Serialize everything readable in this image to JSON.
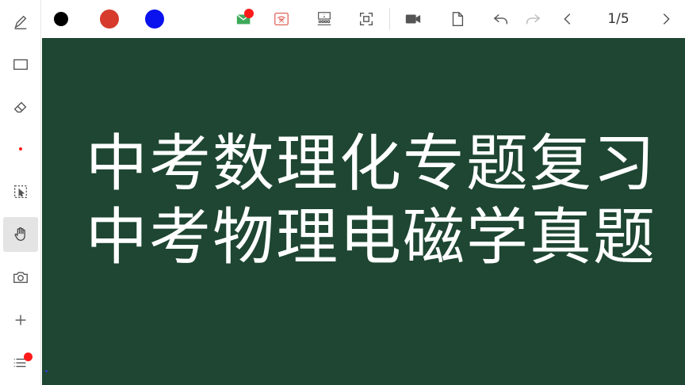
{
  "toolbar": {
    "colors": [
      {
        "name": "black",
        "hex": "#000000"
      },
      {
        "name": "red",
        "hex": "#d63b2b"
      },
      {
        "name": "blue",
        "hex": "#0a12ee"
      }
    ],
    "icons": [
      "envelope-icon",
      "cast-icon",
      "classroom-icon",
      "fullscreen-icon",
      "video-camera-icon",
      "document-icon",
      "undo-icon",
      "redo-icon",
      "prev-page-icon",
      "next-page-icon"
    ],
    "page_indicator": "1/5"
  },
  "sidebar": {
    "tools": [
      "pen-tool",
      "rectangle-tool",
      "eraser-tool",
      "pointer-dot",
      "select-tool",
      "hand-tool",
      "camera-tool",
      "add-tool",
      "menu-tool"
    ],
    "active_tool": "hand-tool"
  },
  "board": {
    "background": "#1e4632",
    "line1": "中考数理化专题复习",
    "line2": "中考物理电磁学真题"
  }
}
